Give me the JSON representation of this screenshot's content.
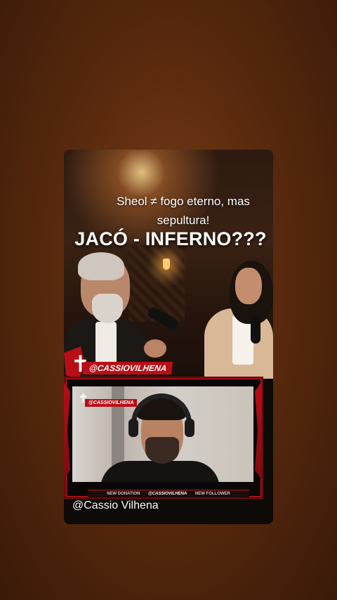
{
  "video": {
    "caption_line1": "Sheol ≠ fogo eterno, mas",
    "caption_line2": "sepultura!",
    "headline": "JACÓ - INFERNO???",
    "podcast_handle_tag": "@CASSIOVILHENA",
    "webcam_handle_tag": "@CASSIOVILHENA",
    "overlay_bar": {
      "left": "NEW DONATION",
      "center": "@CASSIOVILHENA",
      "right": "NEW FOLLOWER"
    },
    "footer_handle": "@Cassio Vilhena"
  },
  "colors": {
    "background": "#5a2a0e",
    "accent_red": "#b80f16",
    "text": "#ffffff"
  },
  "icons": {
    "cross": "cross-icon"
  }
}
